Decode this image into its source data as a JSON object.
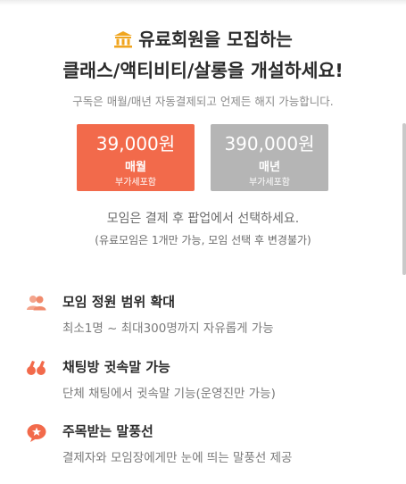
{
  "header": {
    "icon": "bank-icon",
    "line1": "유료회원을 모집하는",
    "line2": "클래스/액티비티/살롱을 개설하세요!",
    "subnote": "구독은 매월/매년 자동결제되고 언제든 해지 가능합니다."
  },
  "plans": [
    {
      "price": "39,000원",
      "period": "매월",
      "vat": "부가세포함",
      "selected": true
    },
    {
      "price": "390,000원",
      "period": "매년",
      "vat": "부가세포함",
      "selected": false
    }
  ],
  "select_note": {
    "line1": "모임은 결제 후 팝업에서 선택하세요.",
    "line2": "(유료모임은 1개만 가능, 모임 선택 후 변경불가)"
  },
  "features": [
    {
      "icon": "people-icon",
      "title": "모임 정원 범위 확대",
      "desc": "최소1명 ~ 최대300명까지 자유롭게 가능"
    },
    {
      "icon": "quote-icon",
      "title": "채팅방 귓속말 가능",
      "desc": "단체 채팅에서 귓속말 기능(운영진만 가능)"
    },
    {
      "icon": "speech-bubble-star-icon",
      "title": "주목받는 말풍선",
      "desc": "결제자와 모임장에게만 눈에 띄는 말풍선 제공"
    }
  ],
  "colors": {
    "accent": "#f26a4b",
    "inactive_plan": "#b5b5b5",
    "icon_gold": "#f0a51f"
  }
}
